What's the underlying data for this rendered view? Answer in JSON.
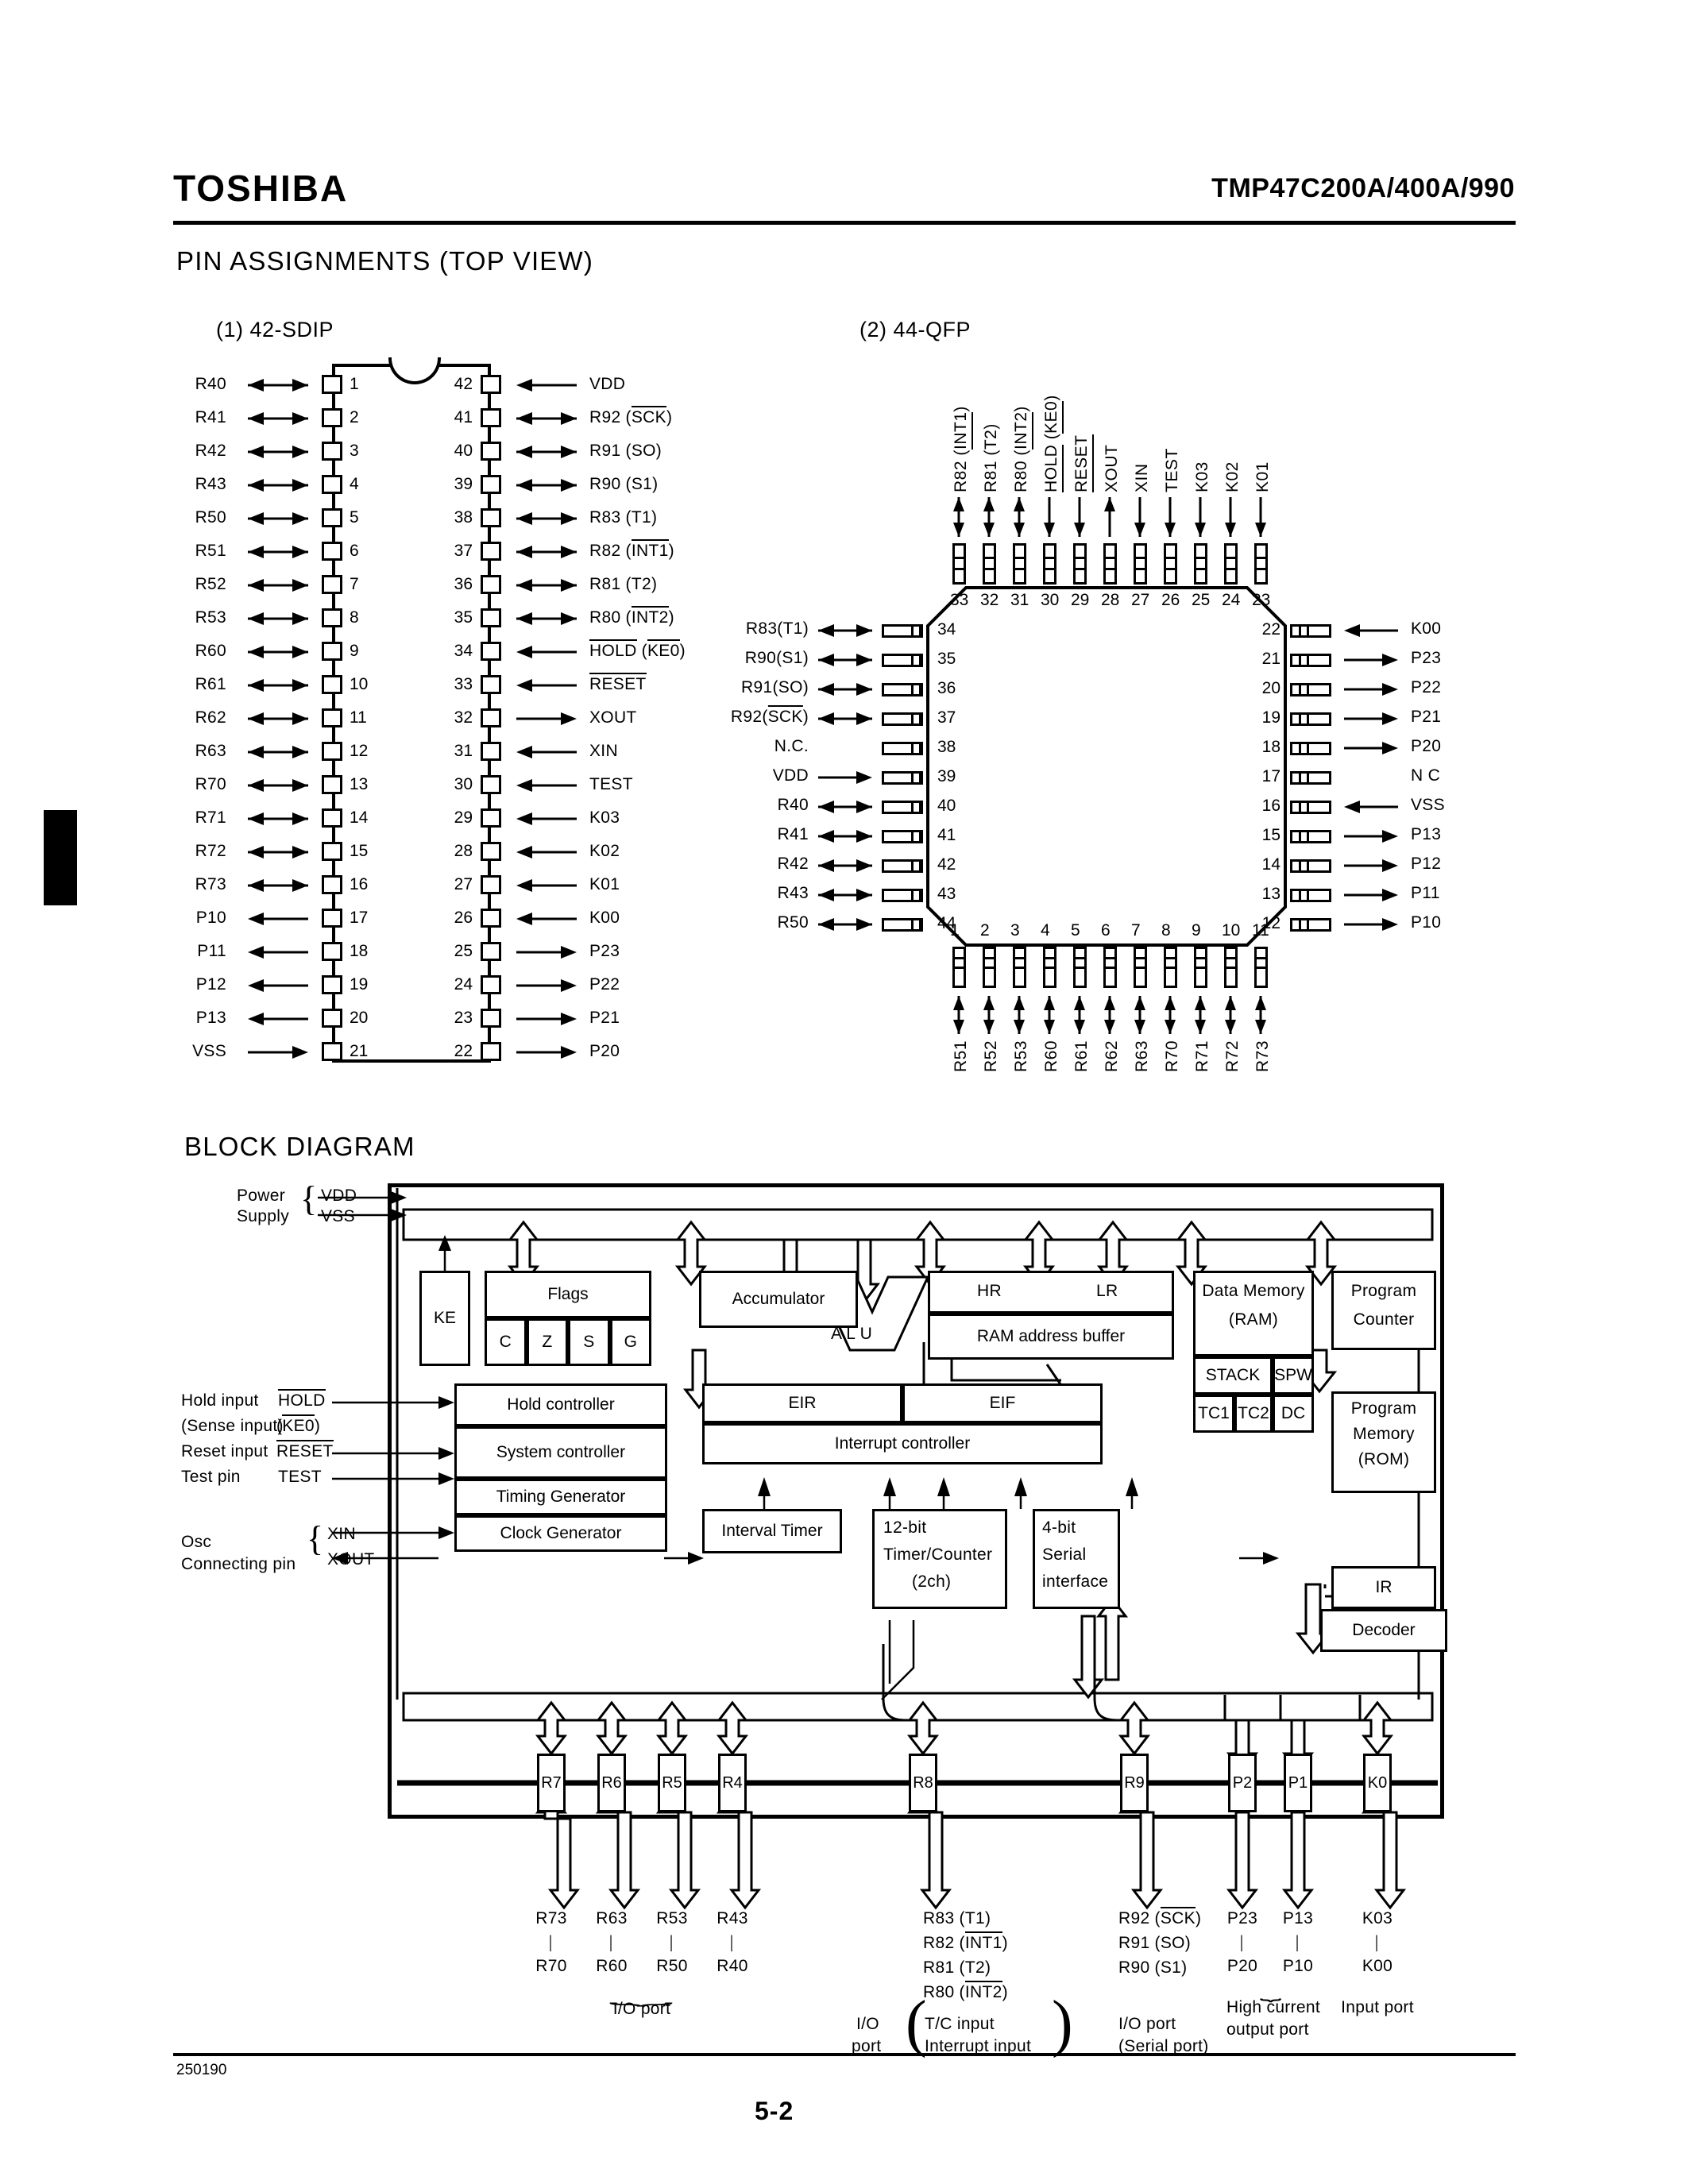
{
  "header": {
    "logo": "TOSHIBA",
    "part_numbers": "TMP47C200A/400A/990"
  },
  "footer": {
    "doc_code": "250190",
    "page_number": "5-2"
  },
  "sections": {
    "pin_assignments_title": "PIN  ASSIGNMENTS (TOP VIEW)",
    "block_diagram_title": "BLOCK DIAGRAM"
  },
  "sdip": {
    "caption": "(1) 42-SDIP",
    "left_pins": [
      {
        "num": "1",
        "label": "R40",
        "dir": "bidir"
      },
      {
        "num": "2",
        "label": "R41",
        "dir": "bidir"
      },
      {
        "num": "3",
        "label": "R42",
        "dir": "bidir"
      },
      {
        "num": "4",
        "label": "R43",
        "dir": "bidir"
      },
      {
        "num": "5",
        "label": "R50",
        "dir": "bidir"
      },
      {
        "num": "6",
        "label": "R51",
        "dir": "bidir"
      },
      {
        "num": "7",
        "label": "R52",
        "dir": "bidir"
      },
      {
        "num": "8",
        "label": "R53",
        "dir": "bidir"
      },
      {
        "num": "9",
        "label": "R60",
        "dir": "bidir"
      },
      {
        "num": "10",
        "label": "R61",
        "dir": "bidir"
      },
      {
        "num": "11",
        "label": "R62",
        "dir": "bidir"
      },
      {
        "num": "12",
        "label": "R63",
        "dir": "bidir"
      },
      {
        "num": "13",
        "label": "R70",
        "dir": "bidir"
      },
      {
        "num": "14",
        "label": "R71",
        "dir": "bidir"
      },
      {
        "num": "15",
        "label": "R72",
        "dir": "bidir"
      },
      {
        "num": "16",
        "label": "R73",
        "dir": "bidir"
      },
      {
        "num": "17",
        "label": "P10",
        "dir": "out-left"
      },
      {
        "num": "18",
        "label": "P11",
        "dir": "out-left"
      },
      {
        "num": "19",
        "label": "P12",
        "dir": "out-left"
      },
      {
        "num": "20",
        "label": "P13",
        "dir": "out-left"
      },
      {
        "num": "21",
        "label": "VSS",
        "dir": "in-right"
      }
    ],
    "right_pins": [
      {
        "num": "42",
        "label": "VDD",
        "over": "",
        "suffix": "",
        "dir": "in-left"
      },
      {
        "num": "41",
        "label": "R92 (",
        "over": "SCK",
        "suffix": ")",
        "dir": "bidir"
      },
      {
        "num": "40",
        "label": "R91 (SO)",
        "over": "",
        "suffix": "",
        "dir": "bidir"
      },
      {
        "num": "39",
        "label": "R90 (S1)",
        "over": "",
        "suffix": "",
        "dir": "bidir"
      },
      {
        "num": "38",
        "label": "R83 (T1)",
        "over": "",
        "suffix": "",
        "dir": "bidir"
      },
      {
        "num": "37",
        "label": "R82 (",
        "over": "INT1",
        "suffix": ")",
        "dir": "bidir"
      },
      {
        "num": "36",
        "label": "R81 (T2)",
        "over": "",
        "suffix": "",
        "dir": "bidir"
      },
      {
        "num": "35",
        "label": "R80 (",
        "over": "INT2",
        "suffix": ")",
        "dir": "bidir"
      },
      {
        "num": "34",
        "label": "",
        "over": "HOLD",
        "suffix": " (KE0)",
        "over2": "KE0",
        "dir": "in-left"
      },
      {
        "num": "33",
        "label": "",
        "over": "RESET",
        "suffix": "",
        "dir": "in-left"
      },
      {
        "num": "32",
        "label": "XOUT",
        "over": "",
        "suffix": "",
        "dir": "out-right"
      },
      {
        "num": "31",
        "label": "XIN",
        "over": "",
        "suffix": "",
        "dir": "in-left"
      },
      {
        "num": "30",
        "label": "TEST",
        "over": "",
        "suffix": "",
        "dir": "in-left"
      },
      {
        "num": "29",
        "label": "K03",
        "over": "",
        "suffix": "",
        "dir": "in-left"
      },
      {
        "num": "28",
        "label": "K02",
        "over": "",
        "suffix": "",
        "dir": "in-left"
      },
      {
        "num": "27",
        "label": "K01",
        "over": "",
        "suffix": "",
        "dir": "in-left"
      },
      {
        "num": "26",
        "label": "K00",
        "over": "",
        "suffix": "",
        "dir": "in-left"
      },
      {
        "num": "25",
        "label": "P23",
        "over": "",
        "suffix": "",
        "dir": "out-right"
      },
      {
        "num": "24",
        "label": "P22",
        "over": "",
        "suffix": "",
        "dir": "out-right"
      },
      {
        "num": "23",
        "label": "P21",
        "over": "",
        "suffix": "",
        "dir": "out-right"
      },
      {
        "num": "22",
        "label": "P20",
        "over": "",
        "suffix": "",
        "dir": "out-right"
      }
    ]
  },
  "qfp": {
    "caption": "(2) 44-QFP",
    "top_pins": [
      {
        "num": "33",
        "pre": "R82 (",
        "over": "INT1",
        "post": ")",
        "dir": "bidir"
      },
      {
        "num": "32",
        "pre": "R81 (T2)",
        "over": "",
        "post": "",
        "dir": "bidir"
      },
      {
        "num": "31",
        "pre": "R80 (",
        "over": "INT2",
        "post": ")",
        "dir": "bidir"
      },
      {
        "num": "30",
        "pre": "",
        "over": "HOLD",
        "post": " (KE0)",
        "over2": "KE0",
        "dir": "in"
      },
      {
        "num": "29",
        "pre": "",
        "over": "RESET",
        "post": "",
        "dir": "in"
      },
      {
        "num": "28",
        "pre": "XOUT",
        "over": "",
        "post": "",
        "dir": "out"
      },
      {
        "num": "27",
        "pre": "XIN",
        "over": "",
        "post": "",
        "dir": "in"
      },
      {
        "num": "26",
        "pre": "TEST",
        "over": "",
        "post": "",
        "dir": "in"
      },
      {
        "num": "25",
        "pre": "K03",
        "over": "",
        "post": "",
        "dir": "in"
      },
      {
        "num": "24",
        "pre": "K02",
        "over": "",
        "post": "",
        "dir": "in"
      },
      {
        "num": "23",
        "pre": "K01",
        "over": "",
        "post": "",
        "dir": "in"
      }
    ],
    "left_pins": [
      {
        "num": "34",
        "pre": "R83(T1)",
        "over": "",
        "post": "",
        "dir": "bidir"
      },
      {
        "num": "35",
        "pre": "R90(S1)",
        "over": "",
        "post": "",
        "dir": "bidir"
      },
      {
        "num": "36",
        "pre": "R91(SO)",
        "over": "",
        "post": "",
        "dir": "bidir"
      },
      {
        "num": "37",
        "pre": "R92(",
        "over": "SCK",
        "post": ")",
        "dir": "bidir"
      },
      {
        "num": "38",
        "pre": "N.C.",
        "over": "",
        "post": "",
        "dir": "none"
      },
      {
        "num": "39",
        "pre": "VDD",
        "over": "",
        "post": "",
        "dir": "in"
      },
      {
        "num": "40",
        "pre": "R40",
        "over": "",
        "post": "",
        "dir": "bidir"
      },
      {
        "num": "41",
        "pre": "R41",
        "over": "",
        "post": "",
        "dir": "bidir"
      },
      {
        "num": "42",
        "pre": "R42",
        "over": "",
        "post": "",
        "dir": "bidir"
      },
      {
        "num": "43",
        "pre": "R43",
        "over": "",
        "post": "",
        "dir": "bidir"
      },
      {
        "num": "44",
        "pre": "R50",
        "over": "",
        "post": "",
        "dir": "bidir"
      }
    ],
    "right_pins": [
      {
        "num": "22",
        "label": "K00",
        "dir": "in"
      },
      {
        "num": "21",
        "label": "P23",
        "dir": "out"
      },
      {
        "num": "20",
        "label": "P22",
        "dir": "out"
      },
      {
        "num": "19",
        "label": "P21",
        "dir": "out"
      },
      {
        "num": "18",
        "label": "P20",
        "dir": "out"
      },
      {
        "num": "17",
        "label": "N C",
        "dir": "none"
      },
      {
        "num": "16",
        "label": "VSS",
        "dir": "in"
      },
      {
        "num": "15",
        "label": "P13",
        "dir": "out"
      },
      {
        "num": "14",
        "label": "P12",
        "dir": "out"
      },
      {
        "num": "13",
        "label": "P11",
        "dir": "out"
      },
      {
        "num": "12",
        "label": "P10",
        "dir": "out"
      }
    ],
    "bottom_pins": [
      {
        "num": "1",
        "label": "R51",
        "dir": "bidir"
      },
      {
        "num": "2",
        "label": "R52",
        "dir": "bidir"
      },
      {
        "num": "3",
        "label": "R53",
        "dir": "bidir"
      },
      {
        "num": "4",
        "label": "R60",
        "dir": "bidir"
      },
      {
        "num": "5",
        "label": "R61",
        "dir": "bidir"
      },
      {
        "num": "6",
        "label": "R62",
        "dir": "bidir"
      },
      {
        "num": "7",
        "label": "R63",
        "dir": "bidir"
      },
      {
        "num": "8",
        "label": "R70",
        "dir": "bidir"
      },
      {
        "num": "9",
        "label": "R71",
        "dir": "bidir"
      },
      {
        "num": "10",
        "label": "R72",
        "dir": "bidir"
      },
      {
        "num": "11",
        "label": "R73",
        "dir": "bidir"
      }
    ]
  },
  "block": {
    "power_supply_label_1": "Power",
    "power_supply_label_2": "Supply",
    "vdd": "VDD",
    "vss": "VSS",
    "hold_input_label": "Hold input",
    "sense_input_label": "(Sense input)",
    "hold_signal": "HOLD",
    "ke0_signal": "KE0",
    "reset_input_label": "Reset input",
    "reset_signal": "RESET",
    "test_pin_label": "Test pin",
    "test_signal": "TEST",
    "osc_label_1": "Osc",
    "osc_label_2": "Connecting pin",
    "xin": "XIN",
    "xout": "XOUT",
    "ke": "KE",
    "flags": "Flags",
    "flag_bits": [
      "C",
      "Z",
      "S",
      "G"
    ],
    "alu": "A L U",
    "accumulator": "Accumulator",
    "hr": "HR",
    "lr": "LR",
    "ram_address_buffer": "RAM address buffer",
    "data_memory_1": "Data Memory",
    "data_memory_2": "(RAM)",
    "stack": "STACK",
    "spw": "SPW",
    "tc1": "TC1",
    "tc2": "TC2",
    "dc": "DC",
    "program_counter_1": "Program",
    "program_counter_2": "Counter",
    "program_memory_1": "Program",
    "program_memory_2": "Memory",
    "program_memory_3": "(ROM)",
    "ir": "IR",
    "decoder": "Decoder",
    "hold_controller": "Hold controller",
    "system_controller": "System controller",
    "timing_generator": "Timing Generator",
    "clock_generator": "Clock Generator",
    "eir": "EIR",
    "eif": "EIF",
    "interrupt_controller": "Interrupt controller",
    "interval_timer": "Interval Timer",
    "timer_counter_1": "12-bit",
    "timer_counter_2": "Timer/Counter",
    "timer_counter_3": "(2ch)",
    "serial_1": "4-bit",
    "serial_2": "Serial",
    "serial_3": "interface",
    "ports": [
      {
        "name": "R7"
      },
      {
        "name": "R6"
      },
      {
        "name": "R5"
      },
      {
        "name": "R4"
      },
      {
        "name": "R8"
      },
      {
        "name": "R9"
      },
      {
        "name": "P2"
      },
      {
        "name": "P1"
      },
      {
        "name": "K0"
      }
    ],
    "pin_groups": [
      {
        "top": "R73",
        "bottom": "R70"
      },
      {
        "top": "R63",
        "bottom": "R60"
      },
      {
        "top": "R53",
        "bottom": "R50"
      },
      {
        "top": "R43",
        "bottom": "R40"
      }
    ],
    "io_port_caption": "I/O port",
    "r8_lines": [
      {
        "pre": "R83 (T1)",
        "over": "",
        "post": ""
      },
      {
        "pre": "R82 (",
        "over": "INT1",
        "post": ")"
      },
      {
        "pre": "R81 (T2)",
        "over": "",
        "post": ""
      },
      {
        "pre": "R80 (",
        "over": "INT2",
        "post": ")"
      }
    ],
    "r8_caption_1": "I/O",
    "r8_caption_2": "port",
    "r8_caption_3": "T/C input",
    "r8_caption_4": "Interrupt input",
    "r9_lines": [
      {
        "pre": "R92 (",
        "over": "SCK",
        "post": ")"
      },
      {
        "pre": "R91 (SO)",
        "over": "",
        "post": ""
      },
      {
        "pre": "R90 (S1)",
        "over": "",
        "post": ""
      }
    ],
    "r9_caption_1": "I/O port",
    "r9_caption_2": "(Serial port)",
    "p_groups": [
      {
        "top": "P23",
        "bottom": "P20"
      },
      {
        "top": "P13",
        "bottom": "P10"
      }
    ],
    "p_caption_1": "High current",
    "p_caption_2": "output port",
    "k_group": {
      "top": "K03",
      "bottom": "K00"
    },
    "k_caption": "Input port"
  }
}
